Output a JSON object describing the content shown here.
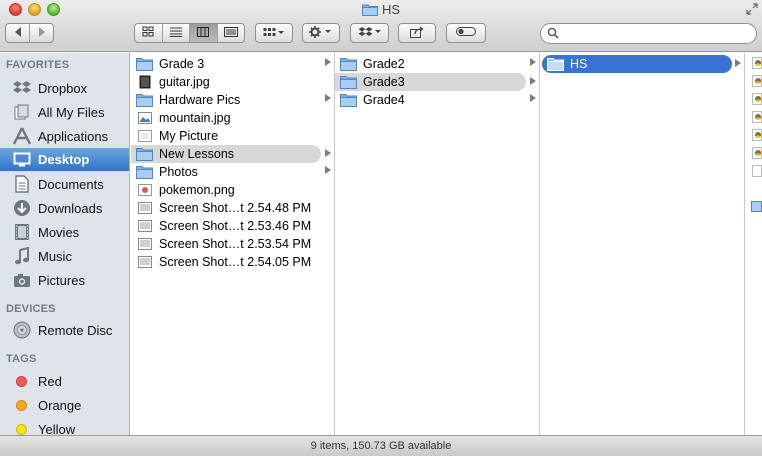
{
  "window": {
    "title": "HS"
  },
  "toolbar": {
    "nav": [
      "chevron-left-icon",
      "chevron-right-icon"
    ],
    "view_modes": [
      "icon-view-icon",
      "list-view-icon",
      "column-view-icon",
      "coverflow-view-icon"
    ],
    "active_view": "column",
    "arrange_icon": "arrange-icon",
    "action_icon": "gear-icon",
    "dropbox_icon": "dropbox-icon",
    "share_icon": "share-icon",
    "tags_icon": "tag-toggle-icon",
    "search": {
      "value": "",
      "placeholder": ""
    }
  },
  "sidebar": {
    "favorites_header": "FAVORITES",
    "favorites": [
      {
        "label": "Dropbox",
        "icon": "dropbox-icon"
      },
      {
        "label": "All My Files",
        "icon": "all-files-icon"
      },
      {
        "label": "Applications",
        "icon": "applications-icon"
      },
      {
        "label": "Desktop",
        "icon": "desktop-icon",
        "selected": true
      },
      {
        "label": "Documents",
        "icon": "documents-icon"
      },
      {
        "label": "Downloads",
        "icon": "downloads-icon"
      },
      {
        "label": "Movies",
        "icon": "movies-icon"
      },
      {
        "label": "Music",
        "icon": "music-icon"
      },
      {
        "label": "Pictures",
        "icon": "pictures-icon"
      }
    ],
    "devices_header": "DEVICES",
    "devices": [
      {
        "label": "Remote Disc",
        "icon": "disc-icon"
      }
    ],
    "tags_header": "TAGS",
    "tags": [
      {
        "label": "Red",
        "color": "#f05a55"
      },
      {
        "label": "Orange",
        "color": "#f5a623"
      },
      {
        "label": "Yellow",
        "color": "#f2e21e"
      }
    ]
  },
  "column1": {
    "items": [
      {
        "name": "Grade 3",
        "icon": "folder-icon",
        "has_children": true
      },
      {
        "name": "guitar.jpg",
        "icon": "image-file-icon"
      },
      {
        "name": "Hardware Pics",
        "icon": "folder-icon",
        "has_children": true
      },
      {
        "name": "mountain.jpg",
        "icon": "image-file-icon"
      },
      {
        "name": "My Picture",
        "icon": "image-file-icon"
      },
      {
        "name": "New Lessons",
        "icon": "folder-icon",
        "has_children": true,
        "highlighted": true
      },
      {
        "name": "Photos",
        "icon": "folder-icon",
        "has_children": true
      },
      {
        "name": "pokemon.png",
        "icon": "image-file-icon"
      },
      {
        "name": "Screen Shot…t 2.54.48 PM",
        "icon": "screenshot-icon"
      },
      {
        "name": "Screen Shot…t 2.53.46 PM",
        "icon": "screenshot-icon"
      },
      {
        "name": "Screen Shot…t 2.53.54 PM",
        "icon": "screenshot-icon"
      },
      {
        "name": "Screen Shot…t 2.54.05 PM",
        "icon": "screenshot-icon"
      }
    ]
  },
  "column2": {
    "items": [
      {
        "name": "Grade2",
        "icon": "folder-icon",
        "has_children": true
      },
      {
        "name": "Grade3",
        "icon": "folder-icon",
        "has_children": true,
        "highlighted": true
      },
      {
        "name": "Grade4",
        "icon": "folder-icon",
        "has_children": true
      }
    ]
  },
  "column3": {
    "items": [
      {
        "name": "HS",
        "icon": "folder-icon",
        "has_children": true,
        "selected": true
      }
    ]
  },
  "status": {
    "text": "9 items, 150.73 GB available"
  }
}
